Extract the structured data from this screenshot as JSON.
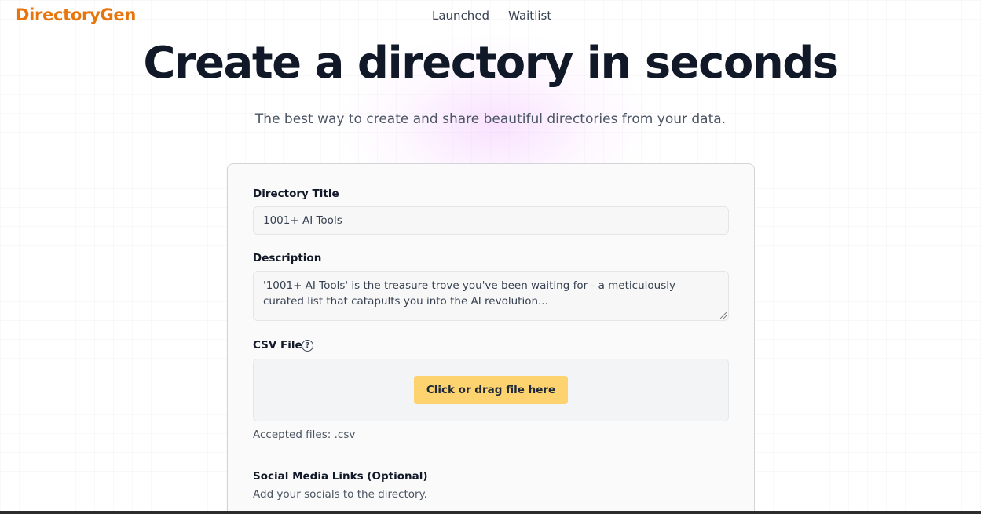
{
  "header": {
    "logo": "DirectoryGen",
    "nav": [
      "Launched",
      "Waitlist"
    ]
  },
  "hero": {
    "title": "Create a directory in seconds",
    "subtitle": "The best way to create and share beautiful directories from your data."
  },
  "form": {
    "title_label": "Directory Title",
    "title_value": "1001+ AI Tools",
    "description_label": "Description",
    "description_value": "'1001+ AI Tools' is the treasure trove you've been waiting for - a meticulously curated list that catapults you into the AI revolution...",
    "csv_label": "CSV File",
    "help_icon": "?",
    "upload_button": "Click or drag file here",
    "accepted_files": "Accepted files: .csv",
    "social_label": "Social Media Links (Optional)",
    "social_hint": "Add your socials to the directory."
  },
  "colors": {
    "brand": "#e8740c",
    "button": "#fcd36f"
  }
}
